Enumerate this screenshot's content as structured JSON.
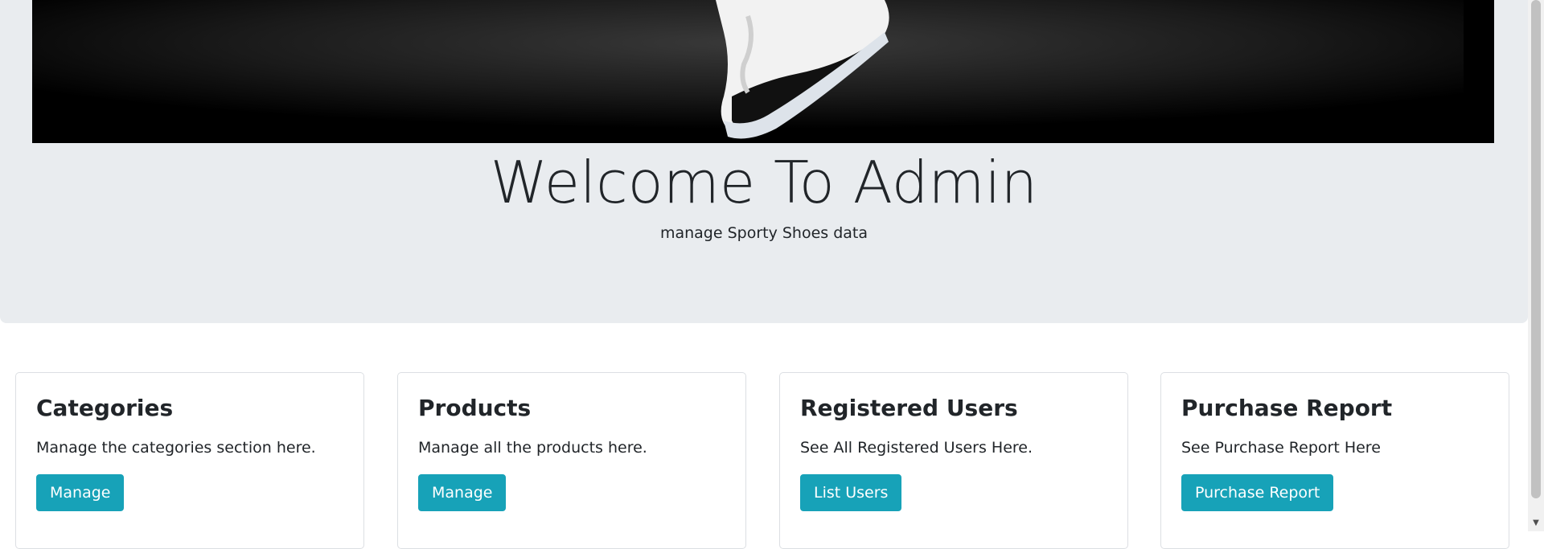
{
  "jumbotron": {
    "title": "Welcome To Admin",
    "subtitle": "manage Sporty Shoes data"
  },
  "cards": [
    {
      "title": "Categories",
      "text": "Manage the categories section here.",
      "button": "Manage"
    },
    {
      "title": "Products",
      "text": "Manage all the products here.",
      "button": "Manage"
    },
    {
      "title": "Registered Users",
      "text": "See All Registered Users Here.",
      "button": "List Users"
    },
    {
      "title": "Purchase Report",
      "text": "See Purchase Report Here",
      "button": "Purchase Report"
    }
  ],
  "colors": {
    "jumbotron_bg": "#e9ecef",
    "button_bg": "#17a2b8",
    "text": "#212529"
  },
  "icons": {
    "scroll_down": "▼"
  }
}
